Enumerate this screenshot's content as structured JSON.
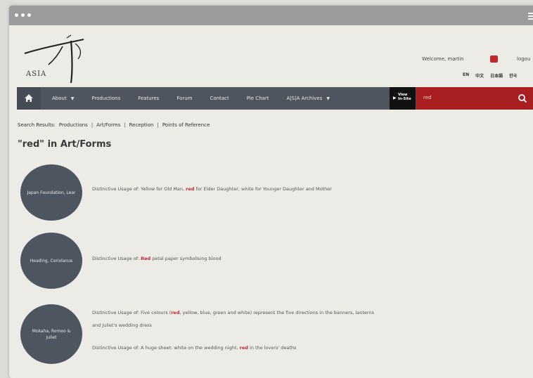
{
  "window": {
    "dots": 3
  },
  "header": {
    "logo_text": "ASIA",
    "welcome": "Welcome, martin",
    "logout": "logou",
    "languages": [
      "EN",
      "中文",
      "日本語",
      "한국"
    ]
  },
  "nav": {
    "items": [
      {
        "label": "About",
        "has_caret": true
      },
      {
        "label": "Productions",
        "has_caret": false
      },
      {
        "label": "Features",
        "has_caret": false
      },
      {
        "label": "Forum",
        "has_caret": false
      },
      {
        "label": "Contact",
        "has_caret": false
      },
      {
        "label": "Pie Chart",
        "has_caret": false
      },
      {
        "label": "A|S|A Archives",
        "has_caret": true
      }
    ],
    "inzone_label": "View In-Site",
    "search_value": "red"
  },
  "breadcrumb": {
    "prefix": "Search Results:",
    "items": [
      "Productions",
      "Art/Forms",
      "Reception",
      "Points of Reference"
    ]
  },
  "page_title": "\"red\" in Art/Forms",
  "results": [
    {
      "circle_label": "Japan Foundation, Lear",
      "entries": [
        {
          "before": "Distinctive Usage of: Yellow for Old Man, ",
          "highlight": "red",
          "after": " for Elder Daughter, white for Younger Daughter and Mother"
        }
      ]
    },
    {
      "circle_label": "Heading, Coriolanus",
      "entries": [
        {
          "before": "Distinctive Usage of: ",
          "highlight": "Red",
          "after": " petal paper symbolising blood"
        }
      ]
    },
    {
      "circle_label": "Mokaha, Romeo & Juliet",
      "entries": [
        {
          "before": "Distinctive Usage of: Five colours (",
          "highlight": "red",
          "after": ", yellow, blue, green and white) represent the five directions in the banners, lanterns"
        },
        {
          "before": "and Juliet's wedding dress",
          "highlight": "",
          "after": ""
        },
        {
          "before": "Distinctive Usage of: A huge sheet: white on the wedding night, ",
          "highlight": "red",
          "after": " in the lovers' deaths"
        }
      ]
    }
  ],
  "colors": {
    "accent": "#a81e21",
    "nav_bg": "#4f555f",
    "circle": "#4d5560"
  }
}
